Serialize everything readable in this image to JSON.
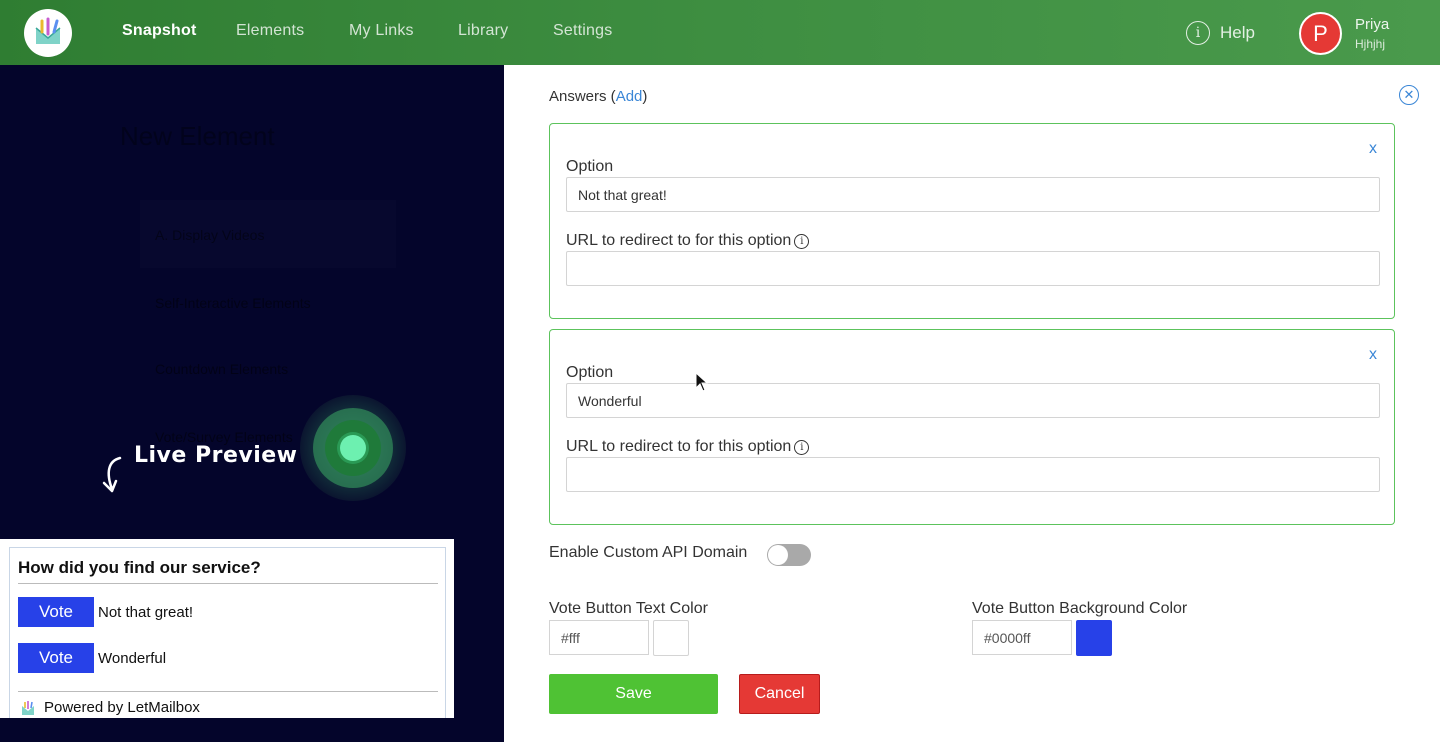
{
  "nav": {
    "items": [
      {
        "label": "Snapshot",
        "active": true
      },
      {
        "label": "Elements"
      },
      {
        "label": "My Links"
      },
      {
        "label": "Library"
      },
      {
        "label": "Settings"
      }
    ],
    "help_label": "Help",
    "user": {
      "initial": "P",
      "name": "Priya",
      "subtitle": "Hjhjhj"
    }
  },
  "left": {
    "ghost_title": "New Element",
    "ghost_items": [
      "A. Display Videos",
      "Self-Interactive Elements",
      "Countdown Elements",
      "Vote/Survey Elements"
    ],
    "live_preview_label": "Live Preview"
  },
  "preview": {
    "question": "How did you find our service?",
    "vote_label": "Vote",
    "options": [
      "Not that great!",
      "Wonderful"
    ],
    "powered_by": "Powered by LetMailbox"
  },
  "form": {
    "answers_label": "Answers (",
    "add_label": "Add",
    "answers_close": ")",
    "option_label": "Option",
    "url_label": "URL to redirect to for this option",
    "card_close": "x",
    "options": [
      {
        "value": "Not that great!",
        "url": ""
      },
      {
        "value": "Wonderful",
        "url": ""
      }
    ],
    "custom_api_label": "Enable Custom API Domain",
    "custom_api_enabled": false,
    "text_color_label": "Vote Button Text Color",
    "text_color": "#fff",
    "bg_color_label": "Vote Button Background Color",
    "bg_color": "#0000ff",
    "save_label": "Save",
    "cancel_label": "Cancel"
  },
  "colors": {
    "nav_green": "#3e8e41",
    "accent_blue": "#3a86d6",
    "card_border": "#5cc35c",
    "save": "#4fc234",
    "cancel": "#e53935",
    "vote_button": "#2741e8",
    "overlay": "#04052b"
  }
}
